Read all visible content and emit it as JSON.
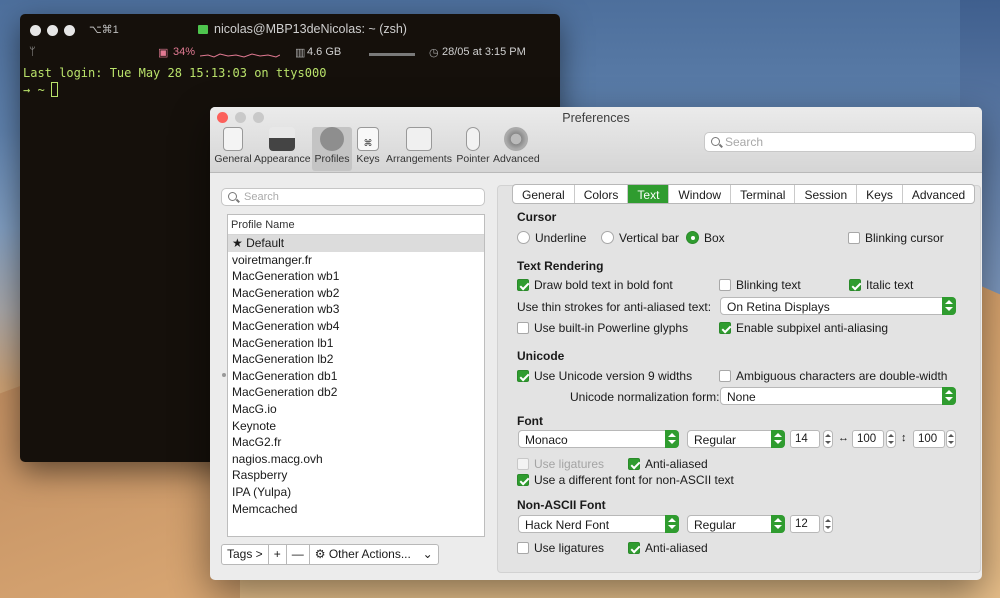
{
  "terminal": {
    "shortcut": "⌥⌘1",
    "title": "nicolas@MBP13deNicolas: ~ (zsh)",
    "cpu": "34%",
    "memory": "4.6 GB",
    "datetime": "28/05 at 3:15 PM",
    "login_line": "Last login: Tue May 28 15:13:03 on ttys000",
    "prompt": "→  ~"
  },
  "prefs": {
    "title": "Preferences",
    "search_placeholder": "Search",
    "toolbar": [
      "General",
      "Appearance",
      "Profiles",
      "Keys",
      "Arrangements",
      "Pointer",
      "Advanced"
    ],
    "profile_search_placeholder": "Search",
    "profile_header": "Profile Name",
    "profiles": [
      "★ Default",
      "voiretmanger.fr",
      "MacGeneration wb1",
      "MacGeneration wb2",
      "MacGeneration wb3",
      "MacGeneration wb4",
      "MacGeneration lb1",
      "MacGeneration lb2",
      "MacGeneration db1",
      "MacGeneration db2",
      "MacG.io",
      "Keynote",
      "MacG2.fr",
      "nagios.macg.ovh",
      "Raspberry",
      "IPA (Yulpa)",
      "Memcached"
    ],
    "bottom": {
      "tags": "Tags >",
      "add": "+",
      "remove": "—",
      "other": "Other Actions..."
    },
    "tabs": [
      "General",
      "Colors",
      "Text",
      "Window",
      "Terminal",
      "Session",
      "Keys",
      "Advanced"
    ],
    "cursor": {
      "heading": "Cursor",
      "underline": "Underline",
      "vertical": "Vertical bar",
      "box": "Box",
      "blinking": "Blinking cursor"
    },
    "rendering": {
      "heading": "Text Rendering",
      "bold": "Draw bold text in bold font",
      "blinking_text": "Blinking text",
      "italic": "Italic text",
      "thin_label": "Use thin strokes for anti-aliased text:",
      "thin_value": "On Retina Displays",
      "powerline": "Use built-in Powerline glyphs",
      "subpixel": "Enable subpixel anti-aliasing"
    },
    "unicode": {
      "heading": "Unicode",
      "v9": "Use Unicode version 9 widths",
      "ambiguous": "Ambiguous characters are double-width",
      "norm_label": "Unicode normalization form:",
      "norm_value": "None"
    },
    "font": {
      "heading": "Font",
      "family": "Monaco",
      "style": "Regular",
      "size": "14",
      "hspace": "100",
      "vspace": "100",
      "ligatures": "Use ligatures",
      "antialiased": "Anti-aliased",
      "different": "Use a different font for non-ASCII text"
    },
    "nonascii": {
      "heading": "Non-ASCII Font",
      "family": "Hack Nerd Font",
      "style": "Regular",
      "size": "12",
      "ligatures": "Use ligatures",
      "antialiased": "Anti-aliased"
    }
  }
}
